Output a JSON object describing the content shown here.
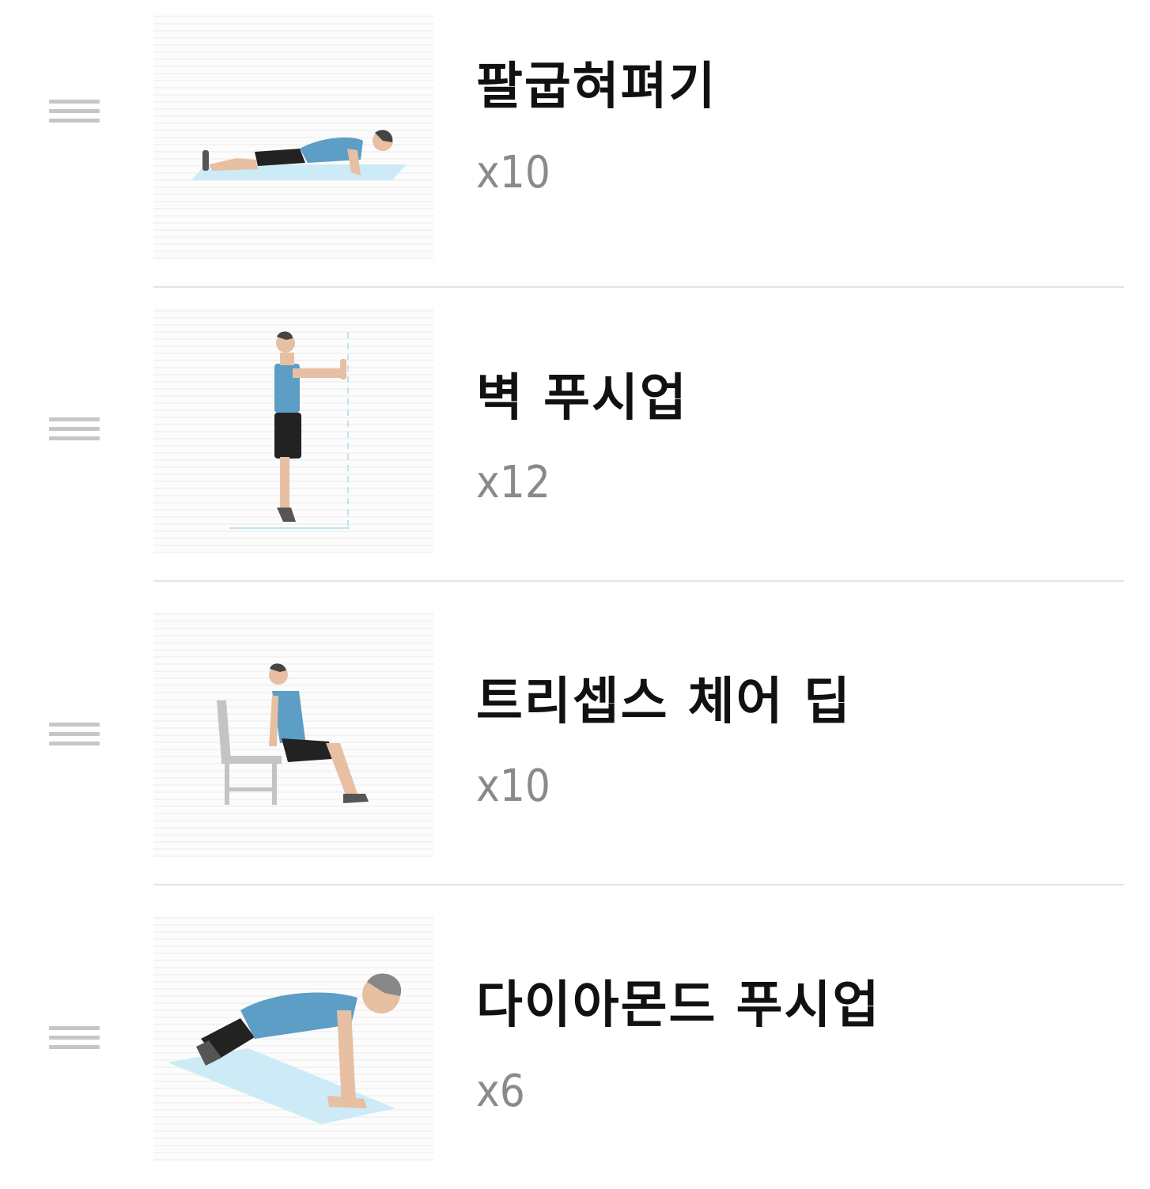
{
  "exercises": [
    {
      "title": "팔굽혀펴기",
      "reps": "x10",
      "illustration": "push-up-figure"
    },
    {
      "title": "벽 푸시업",
      "reps": "x12",
      "illustration": "wall-push-up-figure"
    },
    {
      "title": "트리셉스 체어 딥",
      "reps": "x10",
      "illustration": "triceps-chair-dip-figure"
    },
    {
      "title": "다이아몬드 푸시업",
      "reps": "x6",
      "illustration": "diamond-push-up-figure"
    }
  ],
  "colors": {
    "title": "#111111",
    "reps": "#8a8a8a",
    "divider": "#e4e4e4",
    "drag_handle": "#c6c6c6",
    "shirt": "#5c9ec5",
    "mat": "#cdeaf7"
  },
  "icons": {
    "drag_handle": "drag-handle-icon"
  }
}
